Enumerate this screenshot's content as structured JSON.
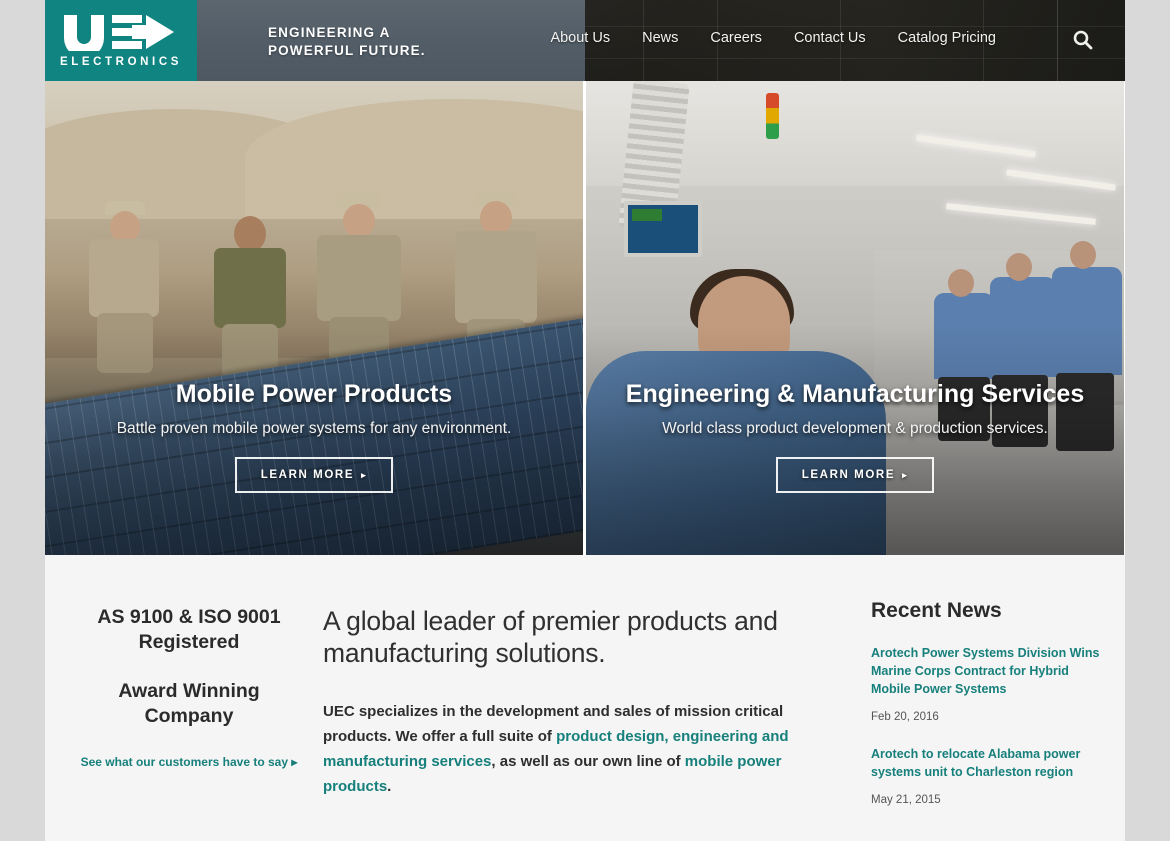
{
  "brand": {
    "logo_word": "ELECTRONICS",
    "logo_icon": "uec-logo-mark",
    "tagline_line1": "ENGINEERING A",
    "tagline_line2": "POWERFUL FUTURE.",
    "teal": "#0f8480",
    "link_teal": "#17807c",
    "header_slate": "#57626c"
  },
  "nav": {
    "items": [
      {
        "label": "About Us"
      },
      {
        "label": "News"
      },
      {
        "label": "Careers"
      },
      {
        "label": "Contact Us"
      },
      {
        "label": "Catalog Pricing"
      }
    ],
    "search_icon": "search-icon"
  },
  "hero": {
    "panels": [
      {
        "title": "Mobile Power Products",
        "subtitle": "Battle proven mobile power systems for any environment.",
        "cta": "LEARN MORE",
        "cta_arrow": "▸"
      },
      {
        "title": "Engineering & Manufacturing Services",
        "subtitle": "World class product development & production services.",
        "cta": "LEARN MORE",
        "cta_arrow": "▸"
      }
    ]
  },
  "certifications": {
    "line1": "AS 9100 & ISO 9001",
    "line2": "Registered",
    "line3": "Award Winning",
    "line4": "Company",
    "testimonial_link": "See what our customers have to say",
    "testimonial_arrow": "▸"
  },
  "intro": {
    "headline": "A global leader of premier products and manufacturing solutions.",
    "paragraph_part1": "UEC specializes in the development and sales of mission critical products. We offer a full suite of ",
    "link1": "product design, engineering and manufacturing services",
    "paragraph_part2": ", as well as our own line of ",
    "link2": "mobile power products",
    "paragraph_part3": "."
  },
  "news": {
    "heading": "Recent News",
    "items": [
      {
        "title": "Arotech Power Systems Division Wins Marine Corps Contract for Hybrid Mobile Power Systems",
        "date": "Feb 20, 2016"
      },
      {
        "title": "Arotech to relocate Alabama power systems unit to Charleston region",
        "date": "May 21, 2015"
      }
    ]
  }
}
